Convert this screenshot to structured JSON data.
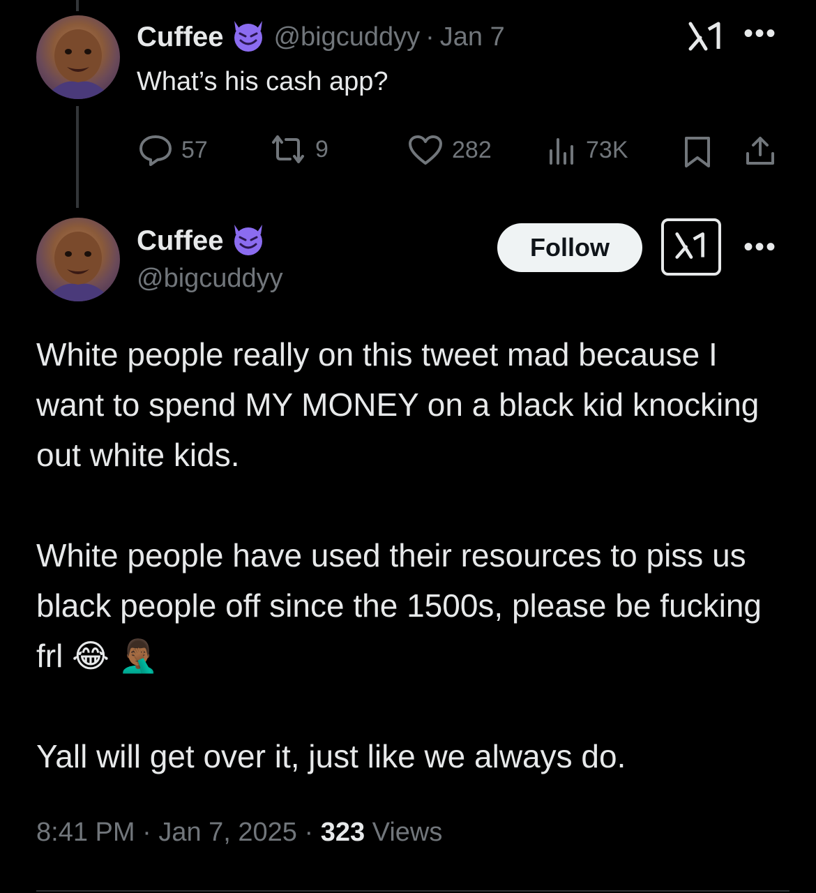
{
  "reply": {
    "name": "Cuffee",
    "handle": "@bigcuddyy",
    "separator": "·",
    "date": "Jan 7",
    "text": "What’s his cash app?",
    "actions": {
      "replies": "57",
      "retweets": "9",
      "likes": "282",
      "views": "73K"
    }
  },
  "main": {
    "name": "Cuffee",
    "handle": "@bigcuddyy",
    "follow_label": "Follow",
    "paragraphs": [
      "White people really on this tweet mad because I want to spend MY MONEY on a black kid knocking out white kids.",
      "White people have used their resources to piss us black people off since the 1500s, please be fucking frl",
      "Yall will get over it, just like we always do."
    ],
    "emojis": [
      "😂",
      "🤦🏾‍♂️"
    ],
    "time": "8:41 PM",
    "date": "Jan 7, 2025",
    "views_count": "323",
    "views_label": "Views"
  },
  "colors": {
    "background": "#000000",
    "text": "#e7e9ea",
    "muted": "#71767b",
    "badge": "#8b6cf0",
    "follow_bg": "#eff3f4"
  },
  "icons": [
    "smiling-devil-icon",
    "grok-icon",
    "more-icon",
    "reply-icon",
    "retweet-icon",
    "like-icon",
    "views-icon",
    "bookmark-icon",
    "share-icon"
  ]
}
